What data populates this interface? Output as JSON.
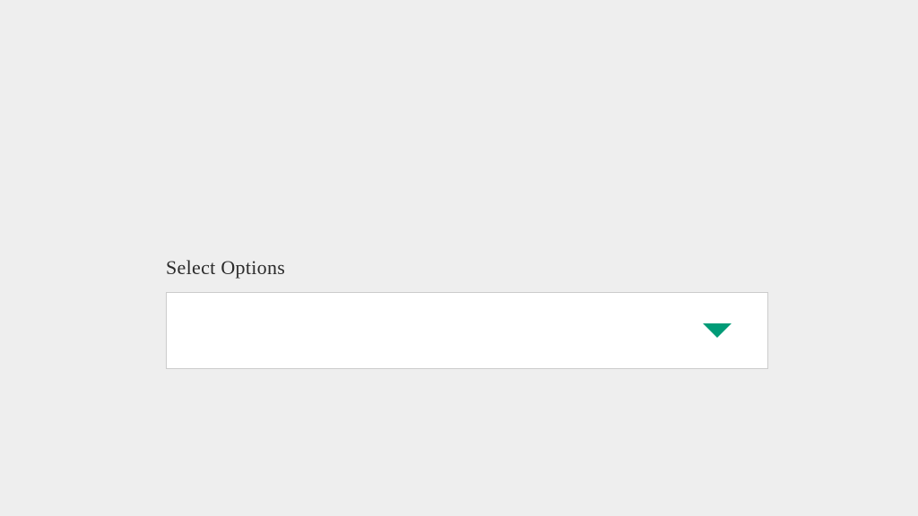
{
  "form": {
    "select": {
      "label": "Select Options",
      "value": "",
      "accent_color": "#009b77"
    }
  }
}
